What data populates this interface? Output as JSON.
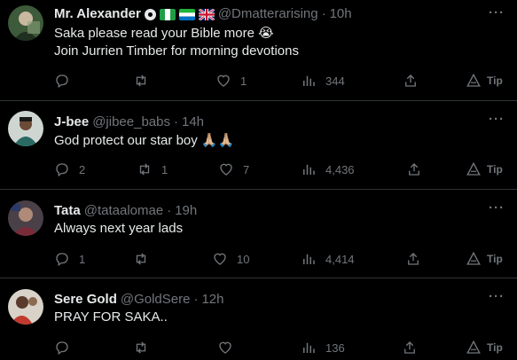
{
  "tweets": [
    {
      "name": "Mr. Alexander",
      "handle": "@Dmatterarising",
      "time": "10h",
      "text": "Saka please read your Bible more 😭\nJoin Jurrien Timber for morning devotions",
      "replies": "",
      "retweets": "",
      "likes": "1",
      "views": "344",
      "tip": "Tip",
      "avatar_color": "#3d5a3a"
    },
    {
      "name": "J-bee",
      "handle": "@jibee_babs",
      "time": "14h",
      "text": "God protect our star boy 🙏🏼🙏🏼",
      "replies": "2",
      "retweets": "1",
      "likes": "7",
      "views": "4,436",
      "tip": "Tip",
      "avatar_color": "#2a6a63"
    },
    {
      "name": "Tata",
      "handle": "@tataalomae",
      "time": "19h",
      "text": "Always next year lads",
      "replies": "1",
      "retweets": "",
      "likes": "10",
      "views": "4,414",
      "tip": "Tip",
      "avatar_color": "#5a4a52"
    },
    {
      "name": "Sere Gold",
      "handle": "@GoldSere",
      "time": "12h",
      "text": "PRAY FOR SAKA..",
      "replies": "",
      "retweets": "",
      "likes": "",
      "views": "136",
      "tip": "Tip",
      "avatar_color": "#7a3a2e"
    }
  ],
  "separator": "·",
  "more_label": "···",
  "colors": {
    "background": "#000000",
    "text": "#e7e9ea",
    "muted": "#71767b",
    "divider": "#2f3336"
  }
}
